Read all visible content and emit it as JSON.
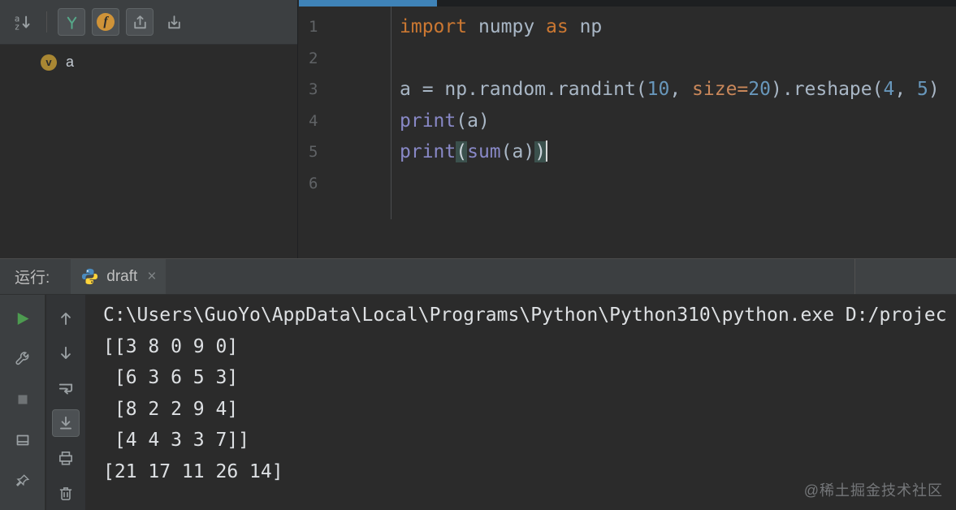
{
  "colors": {
    "accent_blue": "#3f83b8",
    "keyword_orange": "#cc7832",
    "number_blue": "#6897bb",
    "builtin_purple": "#8888c6",
    "run_green": "#4d9b50",
    "f_badge_orange": "#cf9338",
    "match_paren_bg": "#3b514d",
    "panel_bg": "#3c3f41",
    "editor_bg": "#2b2b2b"
  },
  "structure_panel": {
    "toolbar": {
      "buttons": [
        {
          "icon": "sort-alpha",
          "name": "sort-alphabetically-button",
          "pressed": false
        },
        {
          "sep": true
        },
        {
          "icon": "branch",
          "name": "filter-members-button",
          "pressed": true
        },
        {
          "icon": "f-circle",
          "name": "show-functions-button",
          "pressed": true,
          "glyph": "f"
        },
        {
          "icon": "tray-up",
          "name": "autoscroll-to-source-button",
          "pressed": true
        },
        {
          "icon": "tray-down",
          "name": "autoscroll-from-source-button",
          "pressed": false
        }
      ]
    },
    "item_badge": "v",
    "item_label": "a"
  },
  "editor": {
    "lines": [
      {
        "num": "1",
        "tokens": [
          {
            "c": "kw",
            "t": "import"
          },
          {
            "c": "plain",
            "t": " numpy "
          },
          {
            "c": "kw",
            "t": "as"
          },
          {
            "c": "plain",
            "t": " np"
          }
        ]
      },
      {
        "num": "2",
        "tokens": []
      },
      {
        "num": "3",
        "tokens": [
          {
            "c": "plain",
            "t": "a = np.random.randint("
          },
          {
            "c": "num",
            "t": "10"
          },
          {
            "c": "plain",
            "t": ", "
          },
          {
            "c": "arg",
            "t": "size="
          },
          {
            "c": "num",
            "t": "20"
          },
          {
            "c": "plain",
            "t": ").reshape("
          },
          {
            "c": "num",
            "t": "4"
          },
          {
            "c": "plain",
            "t": ", "
          },
          {
            "c": "num",
            "t": "5"
          },
          {
            "c": "plain",
            "t": ")"
          }
        ]
      },
      {
        "num": "4",
        "tokens": [
          {
            "c": "builtin",
            "t": "print"
          },
          {
            "c": "plain",
            "t": "(a)"
          }
        ]
      },
      {
        "num": "5",
        "cursor": true,
        "tokens": [
          {
            "c": "builtin",
            "t": "print"
          },
          {
            "c": "match",
            "t": "("
          },
          {
            "c": "builtin",
            "t": "sum"
          },
          {
            "c": "plain",
            "t": "(a)"
          },
          {
            "c": "match",
            "t": ")"
          }
        ]
      },
      {
        "num": "6",
        "tokens": []
      }
    ]
  },
  "run_panel": {
    "title": "运行:",
    "tab_label": "draft",
    "close_glyph": "×",
    "outer_toolbar": [
      {
        "icon": "play",
        "name": "rerun-button"
      },
      {
        "icon": "wrench",
        "name": "modify-run-configuration-button"
      },
      {
        "icon": "stop",
        "name": "stop-button"
      },
      {
        "icon": "layout",
        "name": "restore-layout-button"
      },
      {
        "icon": "pin",
        "name": "pin-tab-button"
      }
    ],
    "inner_toolbar": [
      {
        "icon": "arrow-up",
        "name": "up-stack-trace-button"
      },
      {
        "icon": "arrow-down",
        "name": "down-stack-trace-button"
      },
      {
        "icon": "soft-wrap",
        "name": "soft-wrap-button"
      },
      {
        "icon": "scroll-end",
        "name": "scroll-to-end-button",
        "pressed": true
      },
      {
        "icon": "printer",
        "name": "print-console-button"
      },
      {
        "icon": "trash",
        "name": "clear-console-button"
      }
    ],
    "console_lines": [
      "C:\\Users\\GuoYo\\AppData\\Local\\Programs\\Python\\Python310\\python.exe D:/projec",
      "[[3 8 0 9 0]",
      " [6 3 6 5 3]",
      " [8 2 2 9 4]",
      " [4 4 3 3 7]]",
      "[21 17 11 26 14]"
    ]
  },
  "watermark": "@稀土掘金技术社区"
}
